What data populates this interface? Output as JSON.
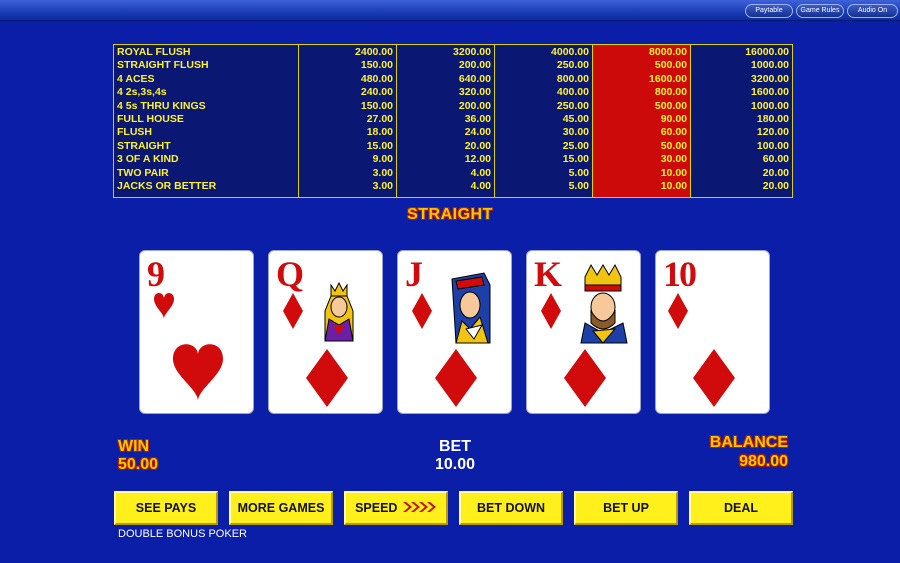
{
  "top_buttons": [
    {
      "label": "Paytable"
    },
    {
      "label": "Game Rules"
    },
    {
      "label": "Audio On"
    }
  ],
  "paytable": {
    "hands": [
      "ROYAL FLUSH",
      "STRAIGHT FLUSH",
      "4 ACES",
      "4 2s,3s,4s",
      "4 5s THRU KINGS",
      "FULL HOUSE",
      "FLUSH",
      "STRAIGHT",
      "3 OF A KIND",
      "TWO PAIR",
      "JACKS OR BETTER"
    ],
    "highlight_column": 4,
    "highlight_color": "#cc0a0a",
    "columns": [
      [
        "2400.00",
        "150.00",
        "480.00",
        "240.00",
        "150.00",
        "27.00",
        "18.00",
        "15.00",
        "9.00",
        "3.00",
        "3.00"
      ],
      [
        "3200.00",
        "200.00",
        "640.00",
        "320.00",
        "200.00",
        "36.00",
        "24.00",
        "20.00",
        "12.00",
        "4.00",
        "4.00"
      ],
      [
        "4000.00",
        "250.00",
        "800.00",
        "400.00",
        "250.00",
        "45.00",
        "30.00",
        "25.00",
        "15.00",
        "5.00",
        "5.00"
      ],
      [
        "8000.00",
        "500.00",
        "1600.00",
        "800.00",
        "500.00",
        "90.00",
        "60.00",
        "50.00",
        "30.00",
        "10.00",
        "10.00"
      ],
      [
        "16000.00",
        "1000.00",
        "3200.00",
        "1600.00",
        "1000.00",
        "180.00",
        "120.00",
        "100.00",
        "60.00",
        "20.00",
        "20.00"
      ]
    ]
  },
  "result_text": "STRAIGHT",
  "cards": [
    {
      "rank": "9",
      "suit": "hearts"
    },
    {
      "rank": "Q",
      "suit": "diamonds",
      "face": "queen"
    },
    {
      "rank": "J",
      "suit": "diamonds",
      "face": "jack"
    },
    {
      "rank": "K",
      "suit": "diamonds",
      "face": "king"
    },
    {
      "rank": "10",
      "suit": "diamonds"
    }
  ],
  "win": {
    "label": "WIN",
    "value": "50.00"
  },
  "bet": {
    "label": "BET",
    "value": "10.00"
  },
  "balance": {
    "label": "BALANCE",
    "value": "980.00"
  },
  "buttons": [
    {
      "label": "SEE PAYS"
    },
    {
      "label": "MORE GAMES"
    },
    {
      "label": "SPEED"
    },
    {
      "label": "BET DOWN"
    },
    {
      "label": "BET UP"
    },
    {
      "label": "DEAL"
    }
  ],
  "game_name": "DOUBLE BONUS POKER",
  "colors": {
    "background": "#0b1ea8",
    "accent_yellow": "#f0c800",
    "card_red": "#d10b0b"
  }
}
